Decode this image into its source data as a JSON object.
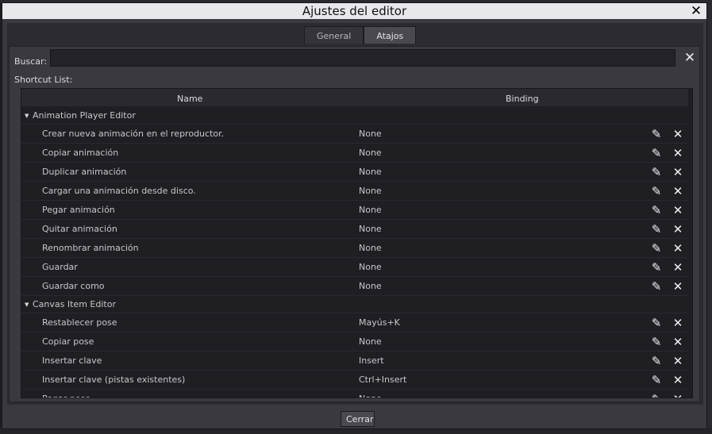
{
  "dialog": {
    "title": "Ajustes del editor",
    "close_icon": "✕",
    "close_button_label": "Cerrar"
  },
  "tabs": [
    {
      "label": "General",
      "active": false
    },
    {
      "label": "Atajos",
      "active": true
    }
  ],
  "search": {
    "label": "Buscar:",
    "value": "",
    "placeholder": "",
    "clear_icon": "✕"
  },
  "shortcut_list": {
    "label": "Shortcut List:",
    "columns": {
      "name": "Name",
      "binding": "Binding"
    }
  },
  "icons": {
    "edit": "✎",
    "delete": "✕",
    "category_arrow": "▼"
  },
  "colors": {
    "title_bar": "#e8e8ec",
    "panel": "#3a3940",
    "tree_bg": "#1f1e23"
  },
  "rows": [
    {
      "type": "category",
      "name": "Animation Player Editor"
    },
    {
      "type": "item",
      "name": "Crear nueva animación en el reproductor.",
      "binding": "None"
    },
    {
      "type": "item",
      "name": "Copiar animación",
      "binding": "None"
    },
    {
      "type": "item",
      "name": "Duplicar animación",
      "binding": "None"
    },
    {
      "type": "item",
      "name": "Cargar una animación desde disco.",
      "binding": "None"
    },
    {
      "type": "item",
      "name": "Pegar animación",
      "binding": "None"
    },
    {
      "type": "item",
      "name": "Quitar animación",
      "binding": "None"
    },
    {
      "type": "item",
      "name": "Renombrar animación",
      "binding": "None"
    },
    {
      "type": "item",
      "name": "Guardar",
      "binding": "None"
    },
    {
      "type": "item",
      "name": "Guardar como",
      "binding": "None"
    },
    {
      "type": "category",
      "name": "Canvas Item Editor"
    },
    {
      "type": "item",
      "name": "Restablecer pose",
      "binding": "Mayús+K"
    },
    {
      "type": "item",
      "name": "Copiar pose",
      "binding": "None"
    },
    {
      "type": "item",
      "name": "Insertar clave",
      "binding": "Insert"
    },
    {
      "type": "item",
      "name": "Insertar clave (pistas existentes)",
      "binding": "Ctrl+Insert"
    },
    {
      "type": "item",
      "name": "Pegar pose",
      "binding": "None"
    }
  ]
}
